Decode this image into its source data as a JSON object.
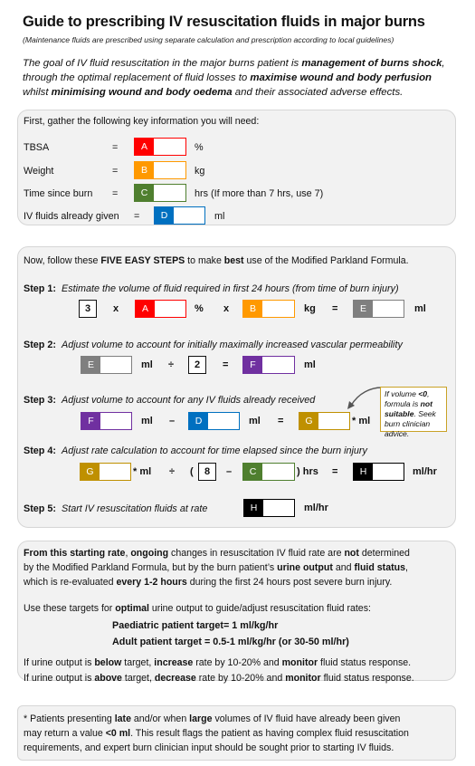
{
  "header": {
    "title": "Guide to prescribing IV resuscitation fluids in major burns",
    "subtitle": "(Maintenance fluids are prescribed using separate calculation and prescription according to local guidelines)",
    "intro": [
      {
        "t": "The goal of IV fluid resuscitation in the major burns patient is ",
        "b": false
      },
      {
        "t": "management of burns shock",
        "b": true
      },
      {
        "t": ", through the optimal replacement of fluid losses to ",
        "b": false
      },
      {
        "t": "maximise wound and body perfusion",
        "b": true
      },
      {
        "t": " whilst ",
        "b": false
      },
      {
        "t": "minimising wound and body oedema",
        "b": true
      },
      {
        "t": " and their associated adverse effects.",
        "b": false
      }
    ]
  },
  "colors": {
    "A": "#ff0000",
    "B": "#ff9900",
    "C": "#4f7f2f",
    "D": "#0070c0",
    "E": "#7f7f7f",
    "F": "#7030a0",
    "G": "#bf9000",
    "H": "#000000",
    "panel_bg": "#f2f2f2",
    "callout_border": "#c9a227"
  },
  "gather": {
    "heading": "First, gather the following key information you will need:",
    "rows": [
      {
        "label": "TBSA",
        "eq": "=",
        "tag": "A",
        "value": "",
        "unit": "%"
      },
      {
        "label": "Weight",
        "eq": "=",
        "tag": "B",
        "value": "",
        "unit": "kg"
      },
      {
        "label": "Time since burn",
        "eq": "=",
        "tag": "C",
        "value": "",
        "unit": "hrs  (If more than 7 hrs, use 7)"
      },
      {
        "label": "IV fluids already given",
        "eq": "=",
        "tag": "D",
        "value": "",
        "unit": "ml"
      }
    ]
  },
  "steps_panel": {
    "intro_pre": "Now, follow these ",
    "intro_b1": "FIVE EASY STEPS",
    "intro_mid": " to make ",
    "intro_b2": "best",
    "intro_post": " use of the Modified Parkland Formula.",
    "step1": {
      "label": "Step 1:",
      "desc": "Estimate the volume of fluid required in first 24 hours (from time of burn injury)",
      "const": "3",
      "op1": "x",
      "unitA": "%",
      "op2": "x",
      "unitB": "kg",
      "eq": "=",
      "unitE": "ml"
    },
    "step2": {
      "label": "Step 2:",
      "desc": "Adjust volume to account for initially maximally increased vascular permeability",
      "unitE": "ml",
      "op": "÷",
      "const": "2",
      "eq": "=",
      "unitF": "ml"
    },
    "step3": {
      "label": "Step 3:",
      "desc": "Adjust volume to account for any IV fluids already received",
      "unitF": "ml",
      "op": "–",
      "unitD": "ml",
      "eq": "=",
      "unitG": "* ml"
    },
    "callout": [
      {
        "t": "If volume ",
        "b": false
      },
      {
        "t": "<0",
        "b": true
      },
      {
        "t": ", formula is ",
        "b": false
      },
      {
        "t": "not suitable",
        "b": true
      },
      {
        "t": ". Seek burn clinician advice.",
        "b": false
      }
    ],
    "step4": {
      "label": "Step 4:",
      "desc": "Adjust rate calculation to account for time elapsed since the burn injury",
      "unitG": "* ml",
      "op": "÷",
      "open": "(",
      "const": "8",
      "minus": "–",
      "close": ") hrs",
      "eq": "=",
      "unitH": "ml/hr"
    },
    "step5": {
      "label": "Step 5:",
      "desc": "Start IV resuscitation fluids at rate",
      "unitH": "ml/hr"
    }
  },
  "ongoing": {
    "para1": [
      {
        "t": "From this starting rate",
        "b": true
      },
      {
        "t": ", ",
        "b": false
      },
      {
        "t": "ongoing",
        "b": true
      },
      {
        "t": " changes in resuscitation IV fluid rate are ",
        "b": false
      },
      {
        "t": "not",
        "b": true
      },
      {
        "t": " determined\nby the Modified Parkland Formula, but by the burn patient’s ",
        "b": false
      },
      {
        "t": "urine output",
        "b": true
      },
      {
        "t": " and ",
        "b": false
      },
      {
        "t": "fluid status",
        "b": true
      },
      {
        "t": ",\nwhich is re-evaluated ",
        "b": false
      },
      {
        "t": "every 1-2 hours",
        "b": true
      },
      {
        "t": " during the first 24 hours post severe burn injury.",
        "b": false
      }
    ],
    "para2": [
      {
        "t": "Use these targets for ",
        "b": false
      },
      {
        "t": "optimal",
        "b": true
      },
      {
        "t": " urine output to guide/adjust resuscitation fluid rates:",
        "b": false
      }
    ],
    "target_paediatric": "Paediatric patient target= 1 ml/kg/hr",
    "target_adult": "Adult patient target = 0.5-1 ml/kg/hr (or 30-50 ml/hr)",
    "below": [
      {
        "t": "If urine output is ",
        "b": false
      },
      {
        "t": "below",
        "b": true
      },
      {
        "t": " target, ",
        "b": false
      },
      {
        "t": "increase",
        "b": true
      },
      {
        "t": " rate by 10-20% and ",
        "b": false
      },
      {
        "t": "monitor",
        "b": true
      },
      {
        "t": " fluid status response.",
        "b": false
      }
    ],
    "above": [
      {
        "t": "If urine output is ",
        "b": false
      },
      {
        "t": "above",
        "b": true
      },
      {
        "t": " target, ",
        "b": false
      },
      {
        "t": "decrease",
        "b": true
      },
      {
        "t": " rate by 10-20% and ",
        "b": false
      },
      {
        "t": "monitor",
        "b": true
      },
      {
        "t": " fluid status response.",
        "b": false
      }
    ]
  },
  "footnote": [
    {
      "t": "* Patients presenting ",
      "b": false
    },
    {
      "t": "late",
      "b": true
    },
    {
      "t": " and/or when ",
      "b": false
    },
    {
      "t": "large",
      "b": true
    },
    {
      "t": " volumes of IV fluid have already been given\nmay return a value ",
      "b": false
    },
    {
      "t": "<0 ml",
      "b": true
    },
    {
      "t": ". This result flags the patient as having complex fluid resuscitation\nrequirements, and expert burn clinician input should be sought prior to starting IV fluids.",
      "b": false
    }
  ]
}
